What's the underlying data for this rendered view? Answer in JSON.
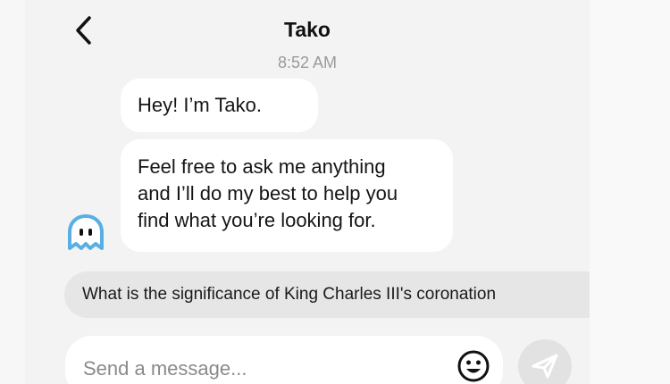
{
  "header": {
    "title": "Tako",
    "timestamp": "8:52 AM",
    "back_icon": "chevron-left-icon"
  },
  "messages": [
    {
      "sender": "Tako",
      "lines": [
        "Hey! I’m Tako."
      ]
    },
    {
      "sender": "Tako",
      "lines": [
        "Feel free to ask me anything",
        "and I’ll do my best to help you",
        "find what you’re looking for."
      ]
    }
  ],
  "bot_avatar_icon": "ghost-avatar-icon",
  "suggestion": {
    "text": "What is the significance of King Charles III's coronation"
  },
  "composer": {
    "placeholder": "Send a message...",
    "emoji_icon": "smiley-icon",
    "send_icon": "send-arrow-icon"
  },
  "colors": {
    "background": "#f3f3f3",
    "bubble": "#ffffff",
    "suggestion": "#e6e6e6",
    "avatar": "#5aaee6",
    "send_button": "#e2e2e2"
  }
}
